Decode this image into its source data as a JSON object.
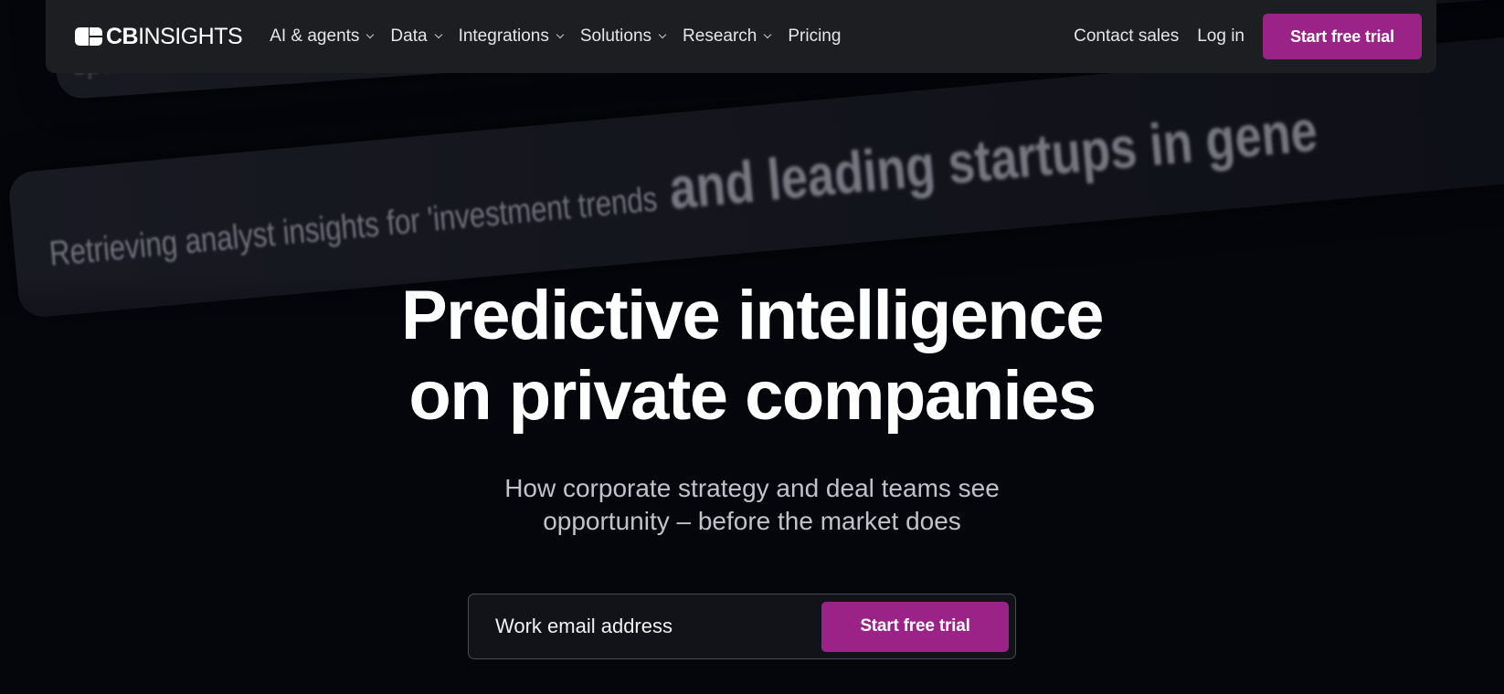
{
  "background": {
    "card1_text": "space",
    "card2_text_light": "Retrieving analyst insights for 'investment trends",
    "card2_text_strong": " and leading startups in gene"
  },
  "logo": {
    "mark_icon": "cb-insights-logo-icon",
    "text_bold": "CB",
    "text_rest": "INSIGHTS"
  },
  "nav": {
    "items": [
      {
        "label": "AI & agents",
        "has_dropdown": true
      },
      {
        "label": "Data",
        "has_dropdown": true
      },
      {
        "label": "Integrations",
        "has_dropdown": true
      },
      {
        "label": "Solutions",
        "has_dropdown": true
      },
      {
        "label": "Research",
        "has_dropdown": true
      },
      {
        "label": "Pricing",
        "has_dropdown": false
      }
    ],
    "contact_sales": "Contact sales",
    "log_in": "Log in",
    "cta": "Start free trial"
  },
  "hero": {
    "title_line1": "Predictive intelligence",
    "title_line2": "on private companies",
    "subtitle_line1": "How corporate strategy and deal teams see",
    "subtitle_line2": "opportunity – before the market does",
    "email_placeholder": "Work email address",
    "cta": "Start free trial"
  },
  "colors": {
    "background": "#05060c",
    "navbar": "#1d1e22",
    "accent": "#9b2286",
    "subtitle": "#c2c3ca"
  }
}
